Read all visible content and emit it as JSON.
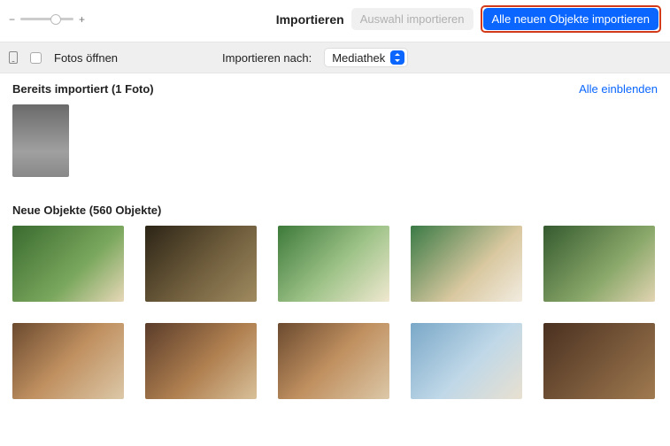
{
  "toolbar": {
    "zoom_minus": "−",
    "zoom_plus": "+",
    "title": "Importieren",
    "import_selection": "Auswahl importieren",
    "import_all_new": "Alle neuen Objekte importieren"
  },
  "options": {
    "open_photos_label": "Fotos öffnen",
    "import_to_label": "Importieren nach:",
    "import_to_value": "Mediathek"
  },
  "sections": {
    "already": {
      "heading": "Bereits importiert (1 Foto)",
      "show_all": "Alle einblenden"
    },
    "new": {
      "heading": "Neue Objekte (560 Objekte)"
    }
  }
}
